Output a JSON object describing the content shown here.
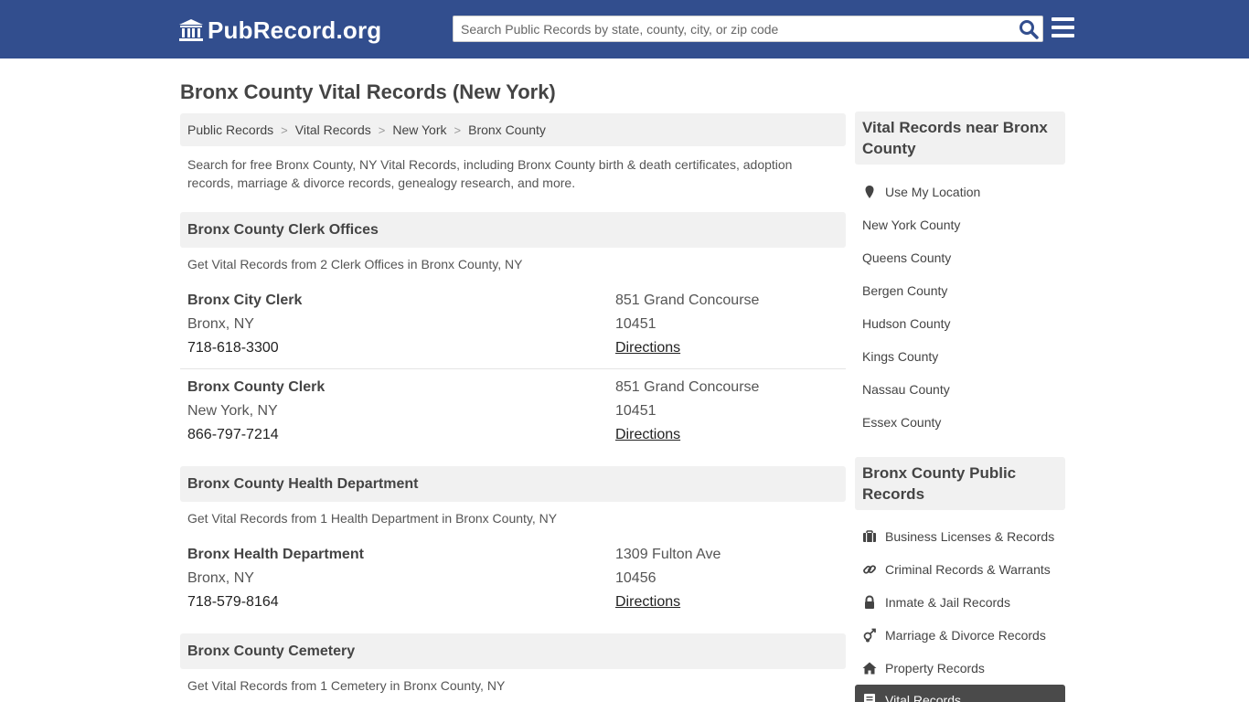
{
  "header": {
    "logo_text": "PubRecord.org",
    "search_placeholder": "Search Public Records by state, county, city, or zip code",
    "brand_color": "#324e8e"
  },
  "page": {
    "title": "Bronx County Vital Records (New York)",
    "breadcrumb": [
      "Public Records",
      "Vital Records",
      "New York",
      "Bronx County"
    ],
    "intro": "Search for free Bronx County, NY Vital Records, including Bronx County birth & death certificates, adoption records, marriage & divorce records, genealogy research, and more."
  },
  "sections": [
    {
      "title": "Bronx County Clerk Offices",
      "subtitle": "Get Vital Records from 2 Clerk Offices in Bronx County, NY",
      "offices": [
        {
          "name": "Bronx City Clerk",
          "city": "Bronx, NY",
          "phone": "718-618-3300",
          "address": "851 Grand Concourse",
          "zip": "10451",
          "directions": "Directions"
        },
        {
          "name": "Bronx County Clerk",
          "city": "New York, NY",
          "phone": "866-797-7214",
          "address": "851 Grand Concourse",
          "zip": "10451",
          "directions": "Directions"
        }
      ]
    },
    {
      "title": "Bronx County Health Department",
      "subtitle": "Get Vital Records from 1 Health Department in Bronx County, NY",
      "offices": [
        {
          "name": "Bronx Health Department",
          "city": "Bronx, NY",
          "phone": "718-579-8164",
          "address": "1309 Fulton Ave",
          "zip": "10456",
          "directions": "Directions"
        }
      ]
    },
    {
      "title": "Bronx County Cemetery",
      "subtitle": "Get Vital Records from 1 Cemetery in Bronx County, NY",
      "offices": []
    }
  ],
  "sidebar": {
    "nearby_title": "Vital Records near Bronx County",
    "use_location": "Use My Location",
    "nearby": [
      "New York County",
      "Queens County",
      "Bergen County",
      "Hudson County",
      "Kings County",
      "Nassau County",
      "Essex County"
    ],
    "public_title": "Bronx County Public Records",
    "public_records": [
      {
        "label": "Business Licenses & Records",
        "icon": "briefcase-icon"
      },
      {
        "label": "Criminal Records & Warrants",
        "icon": "link-icon"
      },
      {
        "label": "Inmate & Jail Records",
        "icon": "lock-icon"
      },
      {
        "label": "Marriage & Divorce Records",
        "icon": "gender-icon"
      },
      {
        "label": "Property Records",
        "icon": "home-icon"
      },
      {
        "label": "Vital Records",
        "icon": "certificate-icon",
        "active": true
      }
    ]
  }
}
